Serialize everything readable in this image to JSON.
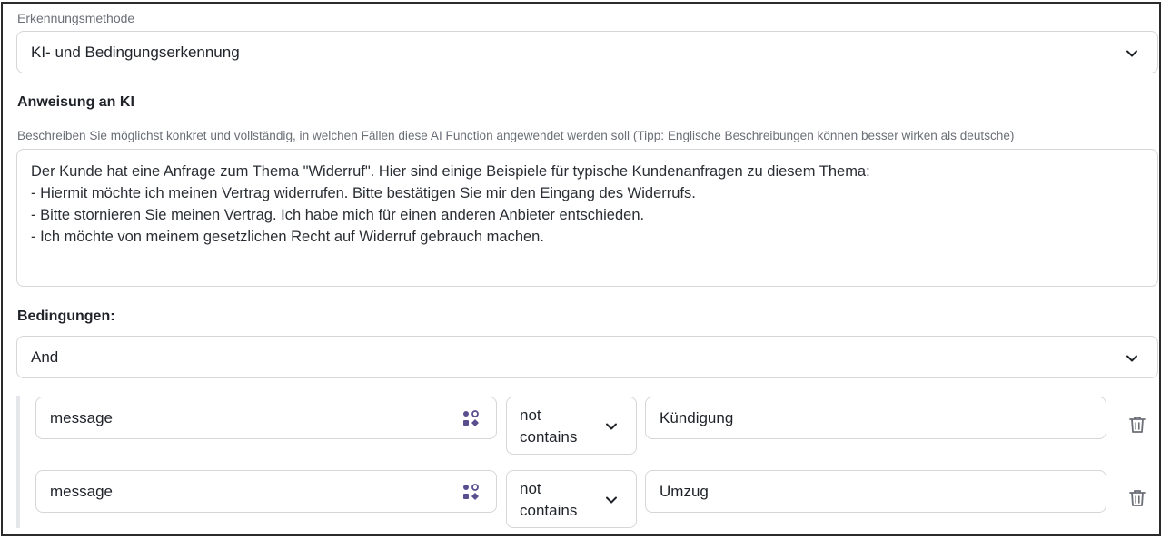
{
  "detection": {
    "label": "Erkennungsmethode",
    "value": "KI- und Bedingungserkennung"
  },
  "instruction": {
    "heading": "Anweisung an KI",
    "help": "Beschreiben Sie möglichst konkret und vollständig, in welchen Fällen diese AI Function angewendet werden soll (Tipp: Englische Beschreibungen können besser wirken als deutsche)",
    "lines": [
      "Der Kunde hat eine Anfrage zum Thema \"Widerruf\". Hier sind einige Beispiele für typische Kundenanfragen zu diesem Thema:",
      "- Hiermit möchte ich meinen Vertrag widerrufen. Bitte bestätigen Sie mir den Eingang des Widerrufs.",
      "- Bitte stornieren Sie meinen Vertrag. Ich habe mich für einen anderen Anbieter entschieden.",
      "- Ich möchte von meinem gesetzlichen Recht auf Widerruf gebrauch machen."
    ]
  },
  "conditions": {
    "heading": "Bedingungen:",
    "logic": "And",
    "rows": [
      {
        "field": "message",
        "operator_line1": "not",
        "operator_line2": "contains",
        "value": "Kündigung"
      },
      {
        "field": "message",
        "operator_line1": "not",
        "operator_line2": "contains",
        "value": "Umzug"
      }
    ]
  },
  "icons": {
    "chevron": "chevron-down-icon",
    "variable": "variable-picker-icon",
    "delete": "trash-icon"
  },
  "colors": {
    "accent": "#5b4e8f",
    "border": "#d4d6da",
    "muted_text": "#6b6f76"
  }
}
